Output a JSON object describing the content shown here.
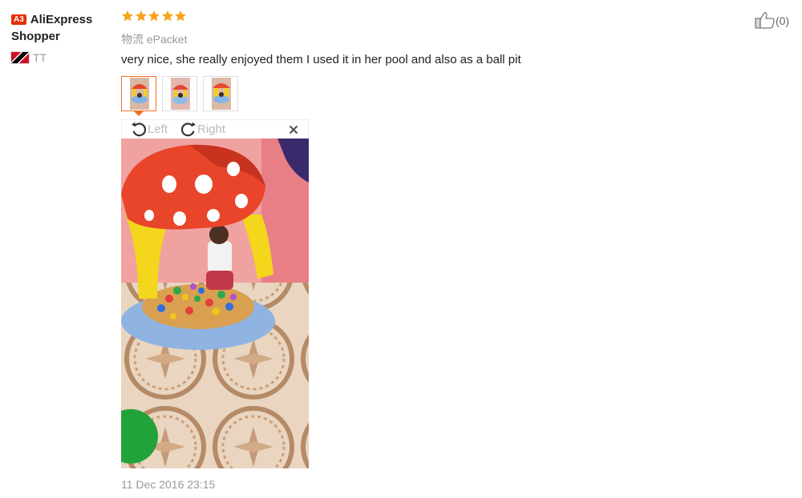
{
  "user": {
    "badge": "A3",
    "name": "AliExpress Shopper",
    "country": "TT",
    "flag_icon": "trinidad-tobago-flag-icon"
  },
  "review": {
    "rating": 5,
    "rating_max": 5,
    "star_color": "#f7a31c",
    "logistics_label": "物流",
    "logistics_value": "ePacket",
    "text": "very nice, she really enjoyed them I used it in her pool and also as a ball pit",
    "date": "11 Dec 2016 23:15",
    "thumbnail_count": 3,
    "active_thumbnail": 1
  },
  "viewer": {
    "rotate_left": "Left",
    "rotate_right": "Right",
    "close_icon": "close-icon"
  },
  "helpful": {
    "icon": "thumbs-up-icon",
    "count_text": "(0)"
  },
  "colors": {
    "accent": "#f26f21",
    "badge": "#e62e04",
    "muted": "#999999"
  }
}
